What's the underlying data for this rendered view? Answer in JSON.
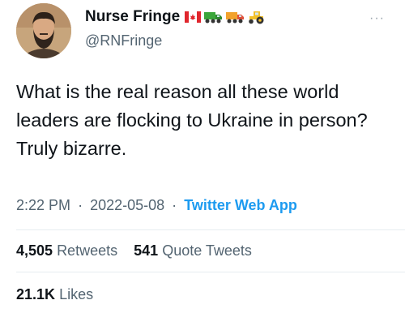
{
  "author": {
    "display_name": "Nurse Fringe",
    "handle": "@RNFringe",
    "name_emojis": [
      "canada-flag-icon",
      "truck-icon",
      "truck-icon",
      "tractor-icon"
    ]
  },
  "tweet": {
    "text": "What is the real reason all these world leaders are flocking to Ukraine in person? Truly bizarre.",
    "time": "2:22 PM",
    "date": "2022-05-08",
    "separator": "·",
    "source": "Twitter Web App"
  },
  "stats": {
    "retweets_count": "4,505",
    "retweets_label": "Retweets",
    "quote_count": "541",
    "quote_label": "Quote Tweets",
    "likes_count": "21.1K",
    "likes_label": "Likes"
  },
  "more_glyph": "···",
  "colors": {
    "text": "#0f1419",
    "secondary": "#536471",
    "link": "#1d9bf0",
    "divider": "#e6ecf0"
  }
}
